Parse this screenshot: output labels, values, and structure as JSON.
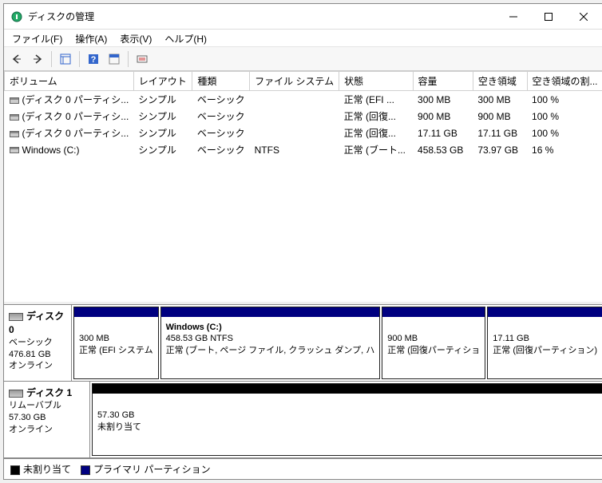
{
  "title": "ディスクの管理",
  "menu": {
    "file": "ファイル(F)",
    "action": "操作(A)",
    "view": "表示(V)",
    "help": "ヘルプ(H)"
  },
  "columns": [
    "ボリューム",
    "レイアウト",
    "種類",
    "ファイル システム",
    "状態",
    "容量",
    "空き領域",
    "空き領域の割..."
  ],
  "volumes": [
    {
      "name": "(ディスク 0 パーティシ...",
      "layout": "シンプル",
      "type": "ベーシック",
      "fs": "",
      "status": "正常 (EFI ...",
      "cap": "300 MB",
      "free": "300 MB",
      "pct": "100 %"
    },
    {
      "name": "(ディスク 0 パーティシ...",
      "layout": "シンプル",
      "type": "ベーシック",
      "fs": "",
      "status": "正常 (回復...",
      "cap": "900 MB",
      "free": "900 MB",
      "pct": "100 %"
    },
    {
      "name": "(ディスク 0 パーティシ...",
      "layout": "シンプル",
      "type": "ベーシック",
      "fs": "",
      "status": "正常 (回復...",
      "cap": "17.11 GB",
      "free": "17.11 GB",
      "pct": "100 %"
    },
    {
      "name": "Windows (C:)",
      "layout": "シンプル",
      "type": "ベーシック",
      "fs": "NTFS",
      "status": "正常 (ブート...",
      "cap": "458.53 GB",
      "free": "73.97 GB",
      "pct": "16 %"
    }
  ],
  "disks": [
    {
      "name": "ディスク 0",
      "type": "ベーシック",
      "size": "476.81 GB",
      "state": "オンライン",
      "parts": [
        {
          "hdr": "primary",
          "title": "",
          "size": "300 MB",
          "status": "正常 (EFI システム"
        },
        {
          "hdr": "primary",
          "title": "Windows  (C:)",
          "size": "458.53 GB NTFS",
          "status": "正常 (ブート, ページ ファイル, クラッシュ ダンプ, ハ"
        },
        {
          "hdr": "primary",
          "title": "",
          "size": "900 MB",
          "status": "正常 (回復パーティショ"
        },
        {
          "hdr": "primary",
          "title": "",
          "size": "17.11 GB",
          "status": "正常 (回復パーティション)"
        }
      ]
    },
    {
      "name": "ディスク 1",
      "type": "リムーバブル",
      "size": "57.30 GB",
      "state": "オンライン",
      "parts": [
        {
          "hdr": "unalloc",
          "title": "",
          "size": "57.30 GB",
          "status": "未割り当て"
        }
      ]
    }
  ],
  "legend": {
    "unalloc": "未割り当て",
    "primary": "プライマリ パーティション"
  }
}
